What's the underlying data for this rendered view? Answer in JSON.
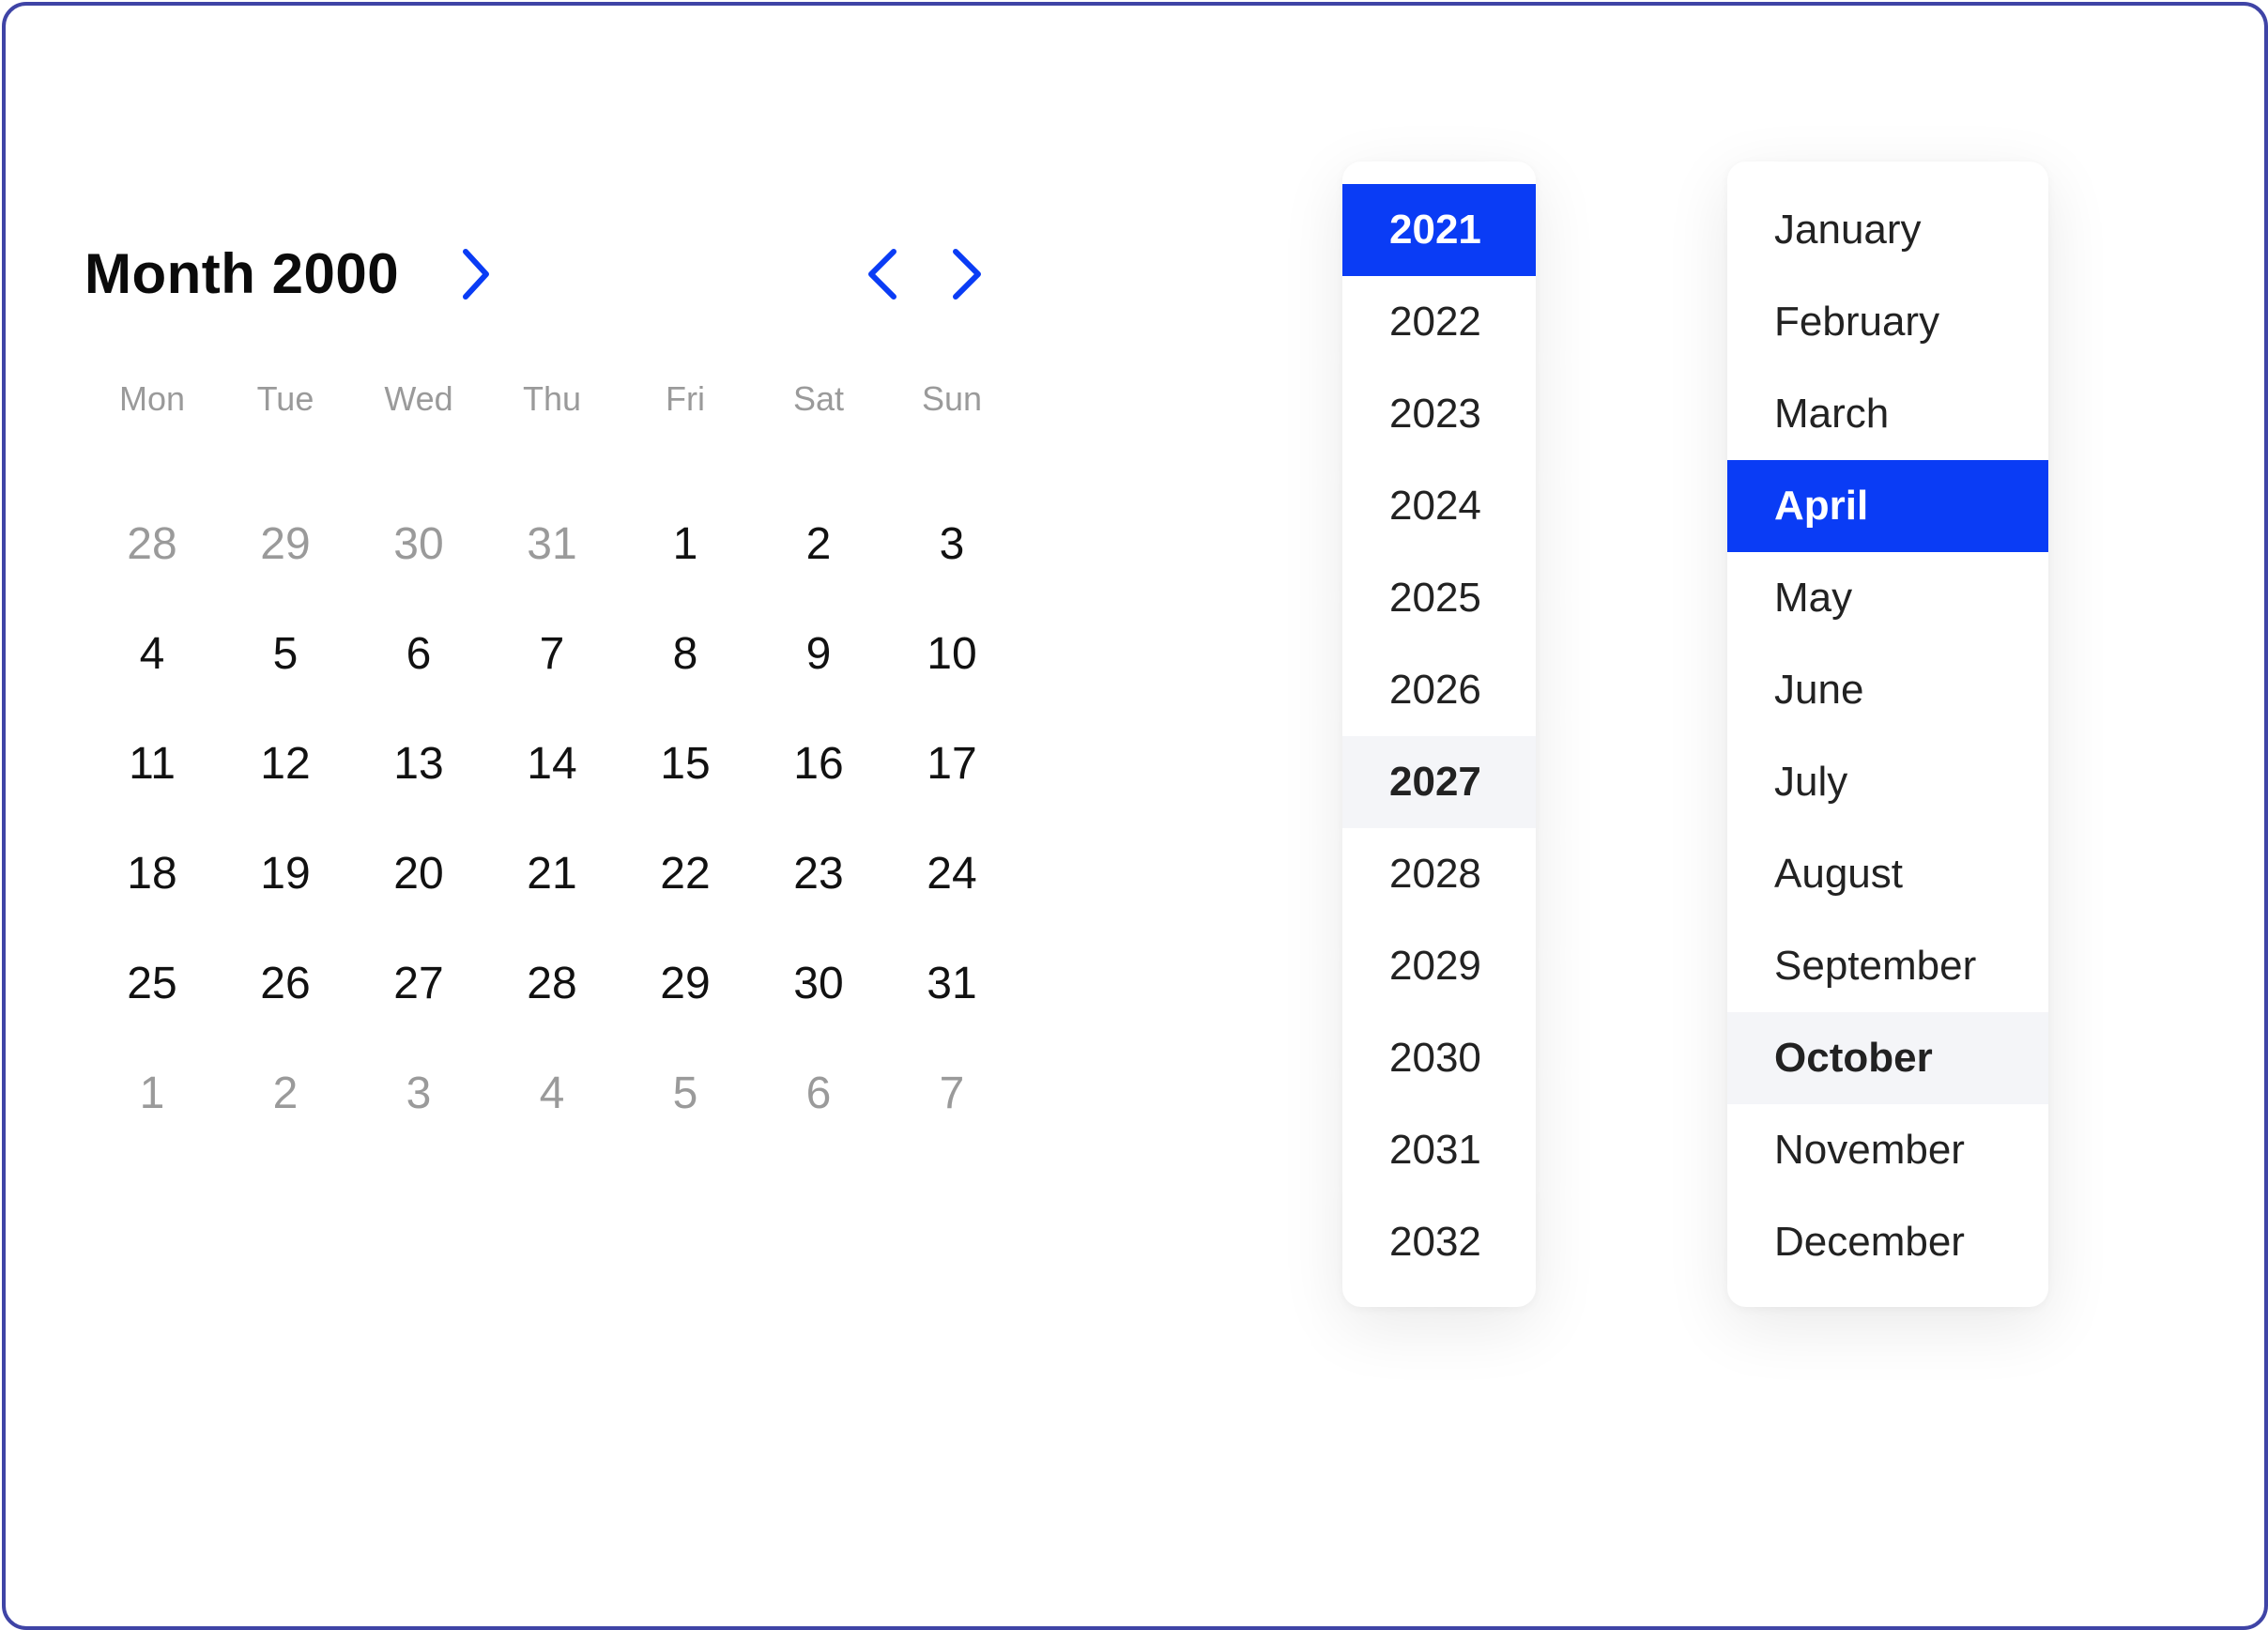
{
  "calendar": {
    "title": "Month 2000",
    "accent_color": "#0a3cf5",
    "title_chevron_icon": "chevron-right-icon",
    "prev_icon": "chevron-left-icon",
    "next_icon": "chevron-right-icon",
    "weekdays": [
      "Mon",
      "Tue",
      "Wed",
      "Thu",
      "Fri",
      "Sat",
      "Sun"
    ],
    "weeks": [
      [
        {
          "d": "28",
          "muted": true
        },
        {
          "d": "29",
          "muted": true
        },
        {
          "d": "30",
          "muted": true
        },
        {
          "d": "31",
          "muted": true
        },
        {
          "d": "1",
          "muted": false
        },
        {
          "d": "2",
          "muted": false
        },
        {
          "d": "3",
          "muted": false
        }
      ],
      [
        {
          "d": "4",
          "muted": false
        },
        {
          "d": "5",
          "muted": false
        },
        {
          "d": "6",
          "muted": false
        },
        {
          "d": "7",
          "muted": false
        },
        {
          "d": "8",
          "muted": false
        },
        {
          "d": "9",
          "muted": false
        },
        {
          "d": "10",
          "muted": false
        }
      ],
      [
        {
          "d": "11",
          "muted": false
        },
        {
          "d": "12",
          "muted": false
        },
        {
          "d": "13",
          "muted": false
        },
        {
          "d": "14",
          "muted": false
        },
        {
          "d": "15",
          "muted": false
        },
        {
          "d": "16",
          "muted": false
        },
        {
          "d": "17",
          "muted": false
        }
      ],
      [
        {
          "d": "18",
          "muted": false
        },
        {
          "d": "19",
          "muted": false
        },
        {
          "d": "20",
          "muted": false
        },
        {
          "d": "21",
          "muted": false
        },
        {
          "d": "22",
          "muted": false
        },
        {
          "d": "23",
          "muted": false
        },
        {
          "d": "24",
          "muted": false
        }
      ],
      [
        {
          "d": "25",
          "muted": false
        },
        {
          "d": "26",
          "muted": false
        },
        {
          "d": "27",
          "muted": false
        },
        {
          "d": "28",
          "muted": false
        },
        {
          "d": "29",
          "muted": false
        },
        {
          "d": "30",
          "muted": false
        },
        {
          "d": "31",
          "muted": false
        }
      ],
      [
        {
          "d": "1",
          "muted": true
        },
        {
          "d": "2",
          "muted": true
        },
        {
          "d": "3",
          "muted": true
        },
        {
          "d": "4",
          "muted": true
        },
        {
          "d": "5",
          "muted": true
        },
        {
          "d": "6",
          "muted": true
        },
        {
          "d": "7",
          "muted": true
        }
      ]
    ]
  },
  "year_dropdown": {
    "selected": "2021",
    "hovered": "2027",
    "options": [
      "2021",
      "2022",
      "2023",
      "2024",
      "2025",
      "2026",
      "2027",
      "2028",
      "2029",
      "2030",
      "2031",
      "2032"
    ]
  },
  "month_dropdown": {
    "selected": "April",
    "hovered": "October",
    "options": [
      "January",
      "February",
      "March",
      "April",
      "May",
      "June",
      "July",
      "August",
      "September",
      "October",
      "November",
      "December"
    ]
  }
}
